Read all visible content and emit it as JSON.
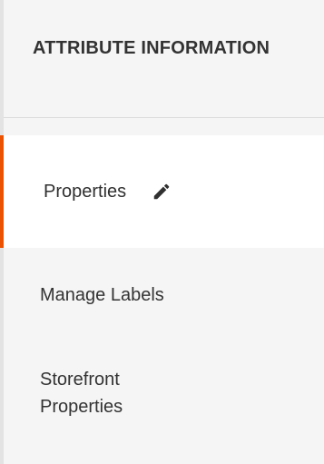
{
  "panel": {
    "title": "ATTRIBUTE INFORMATION"
  },
  "nav": {
    "items": [
      {
        "label": "Properties",
        "active": true,
        "icon": "edit-pencil-icon"
      },
      {
        "label": "Manage Labels",
        "active": false
      },
      {
        "label": "Storefront Properties",
        "active": false
      }
    ]
  },
  "colors": {
    "active_border": "#eb5202",
    "panel_bg": "#f5f5f5",
    "active_bg": "#ffffff",
    "text": "#333333"
  }
}
